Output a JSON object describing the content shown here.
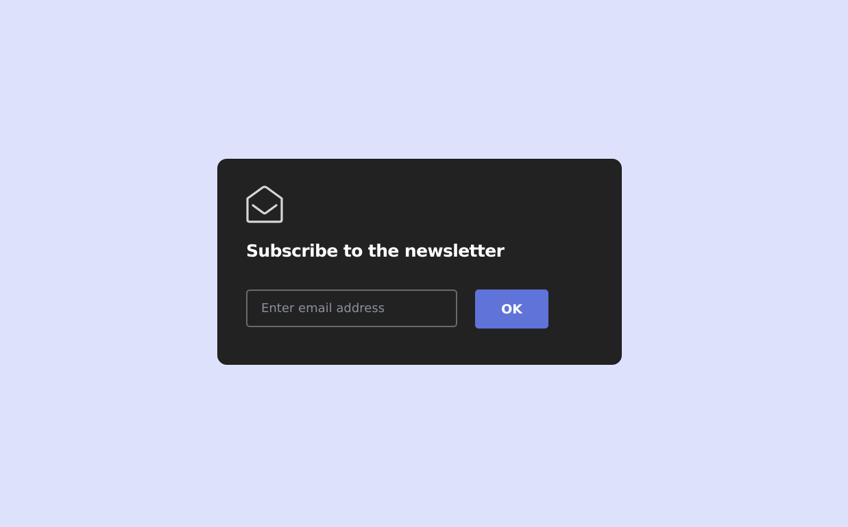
{
  "card": {
    "icon": "envelope-open-icon",
    "title": "Subscribe to the newsletter",
    "email_input": {
      "value": "",
      "placeholder": "Enter email address"
    },
    "submit_label": "OK"
  },
  "colors": {
    "background": "#dee1fc",
    "card": "#222222",
    "accent": "#5f73d9"
  }
}
